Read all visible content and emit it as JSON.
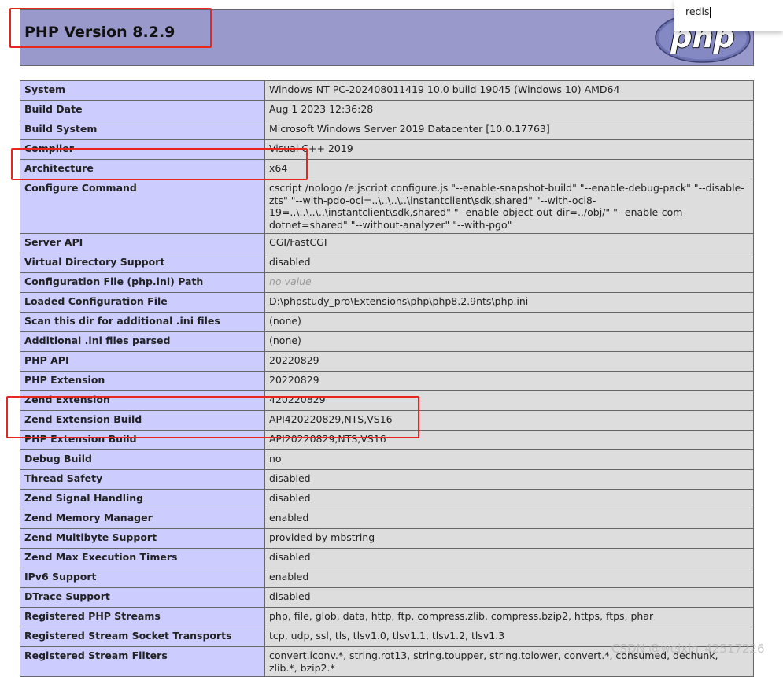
{
  "header": {
    "title": "PHP Version 8.2.9",
    "logo_text": "php",
    "logo_icon": "php-logo-icon"
  },
  "search": {
    "value": "redis"
  },
  "rows": [
    {
      "key": "System",
      "value": "Windows NT PC-202408011419 10.0 build 19045 (Windows 10) AMD64"
    },
    {
      "key": "Build Date",
      "value": "Aug 1 2023 12:36:28"
    },
    {
      "key": "Build System",
      "value": "Microsoft Windows Server 2019 Datacenter [10.0.17763]"
    },
    {
      "key": "Compiler",
      "value": "Visual C++ 2019"
    },
    {
      "key": "Architecture",
      "value": "x64"
    },
    {
      "key": "Configure Command",
      "value": "cscript /nologo /e:jscript configure.js \"--enable-snapshot-build\" \"--enable-debug-pack\" \"--disable-zts\" \"--with-pdo-oci=..\\..\\..\\..\\instantclient\\sdk,shared\" \"--with-oci8-19=..\\..\\..\\..\\instantclient\\sdk,shared\" \"--enable-object-out-dir=../obj/\" \"--enable-com-dotnet=shared\" \"--without-analyzer\" \"--with-pgo\""
    },
    {
      "key": "Server API",
      "value": "CGI/FastCGI"
    },
    {
      "key": "Virtual Directory Support",
      "value": "disabled"
    },
    {
      "key": "Configuration File (php.ini) Path",
      "value": "no value"
    },
    {
      "key": "Loaded Configuration File",
      "value": "D:\\phpstudy_pro\\Extensions\\php\\php8.2.9nts\\php.ini"
    },
    {
      "key": "Scan this dir for additional .ini files",
      "value": "(none)"
    },
    {
      "key": "Additional .ini files parsed",
      "value": "(none)"
    },
    {
      "key": "PHP API",
      "value": "20220829"
    },
    {
      "key": "PHP Extension",
      "value": "20220829"
    },
    {
      "key": "Zend Extension",
      "value": "420220829"
    },
    {
      "key": "Zend Extension Build",
      "value": "API420220829,NTS,VS16"
    },
    {
      "key": "PHP Extension Build",
      "value": "API20220829,NTS,VS16"
    },
    {
      "key": "Debug Build",
      "value": "no"
    },
    {
      "key": "Thread Safety",
      "value": "disabled"
    },
    {
      "key": "Zend Signal Handling",
      "value": "disabled"
    },
    {
      "key": "Zend Memory Manager",
      "value": "enabled"
    },
    {
      "key": "Zend Multibyte Support",
      "value": "provided by mbstring"
    },
    {
      "key": "Zend Max Execution Timers",
      "value": "disabled"
    },
    {
      "key": "IPv6 Support",
      "value": "enabled"
    },
    {
      "key": "DTrace Support",
      "value": "disabled"
    },
    {
      "key": "Registered PHP Streams",
      "value": "php, file, glob, data, http, ftp, compress.zlib, compress.bzip2, https, ftps, phar"
    },
    {
      "key": "Registered Stream Socket Transports",
      "value": "tcp, udp, ssl, tls, tlsv1.0, tlsv1.1, tlsv1.2, tlsv1.3"
    },
    {
      "key": "Registered Stream Filters",
      "value": "convert.iconv.*, string.rot13, string.toupper, string.tolower, convert.*, consumed, dechunk, zlib.*, bzip2.*"
    }
  ],
  "watermark": "CSDN @weixin_42517226",
  "colors": {
    "header_bg": "#9999cc",
    "key_bg": "#ccccff",
    "value_bg": "#dddddd",
    "highlight": "#e8261e"
  }
}
